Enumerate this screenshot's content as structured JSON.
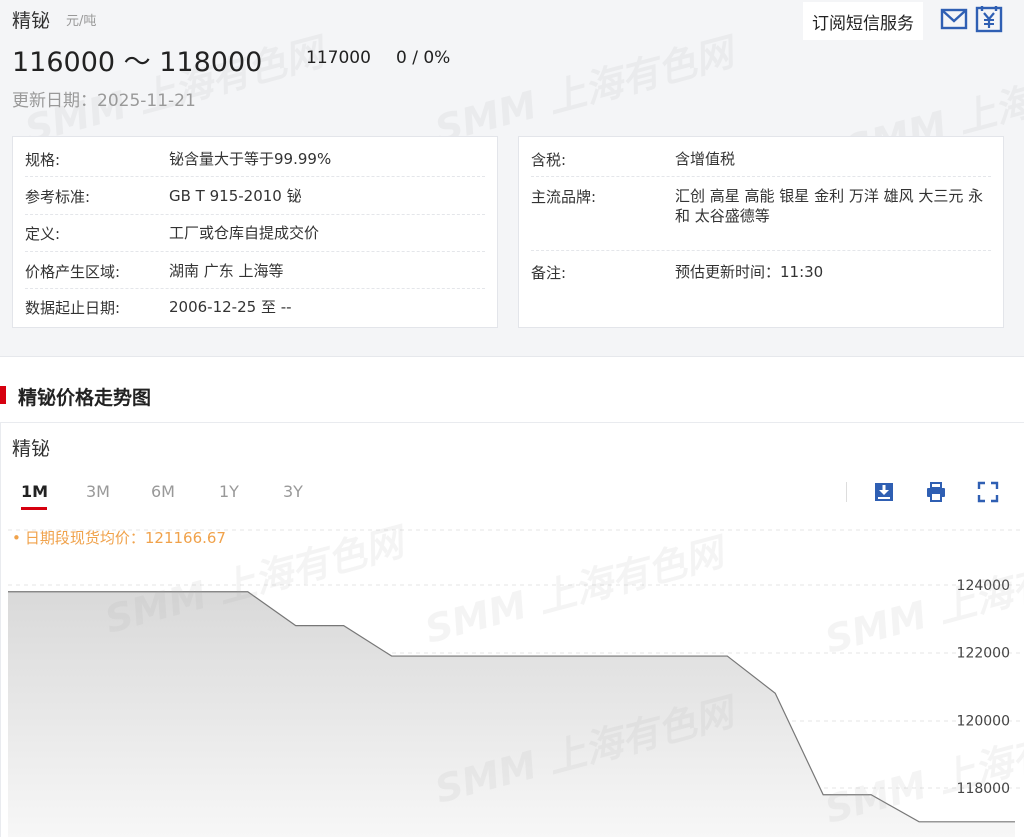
{
  "header": {
    "title": "精铋",
    "unit": "元/吨",
    "price_range": "116000 ～ 118000",
    "average": "117000",
    "change": "0 / 0%",
    "update_label": "更新日期：",
    "update_date": "2025-11-21",
    "subscribe_label": "订阅短信服务"
  },
  "info_left": [
    {
      "label": "规格:",
      "value": "铋含量大于等于99.99%"
    },
    {
      "label": "参考标准:",
      "value": "GB T 915-2010 铋"
    },
    {
      "label": "定义:",
      "value": "工厂或仓库自提成交价"
    },
    {
      "label": "价格产生区域:",
      "value": "湖南 广东 上海等"
    },
    {
      "label": "数据起止日期:",
      "value": "2006-12-25 至 --"
    }
  ],
  "info_right": [
    {
      "label": "含税:",
      "value": "含增值税"
    },
    {
      "label": "主流品牌:",
      "value": "汇创 高星 高能 银星 金利 万洋 雄风 大三元 永和 太谷盛德等"
    },
    {
      "label": "备注:",
      "value": "预估更新时间：11:30"
    }
  ],
  "section": {
    "title": "精铋价格走势图"
  },
  "chart_panel": {
    "title": "精铋",
    "tabs": [
      {
        "label": "1M",
        "active": true
      },
      {
        "label": "3M",
        "active": false
      },
      {
        "label": "6M",
        "active": false
      },
      {
        "label": "1Y",
        "active": false
      },
      {
        "label": "3Y",
        "active": false
      }
    ],
    "avg_text": "日期段现货均价：121166.67",
    "watermark": "SMM 上海有色网"
  },
  "colors": {
    "accent": "#d6000f",
    "avg_text": "#f0a24b",
    "icon_blue": "#2f5fb3"
  },
  "chart_data": {
    "type": "area",
    "x": [
      0,
      1,
      2,
      3,
      4,
      5,
      6,
      7,
      8,
      9,
      10,
      11,
      12,
      13,
      14,
      15,
      16,
      17,
      18,
      19,
      20,
      21
    ],
    "values": [
      123800,
      123800,
      123800,
      123800,
      123800,
      123800,
      122800,
      122800,
      121900,
      121900,
      121900,
      121900,
      121900,
      121900,
      121900,
      121900,
      120800,
      117800,
      117800,
      117000,
      117000,
      117000
    ],
    "y_ticks": [
      "124000",
      "122000",
      "120000",
      "118000"
    ],
    "ylim": [
      116400,
      125000
    ],
    "grid": true
  }
}
